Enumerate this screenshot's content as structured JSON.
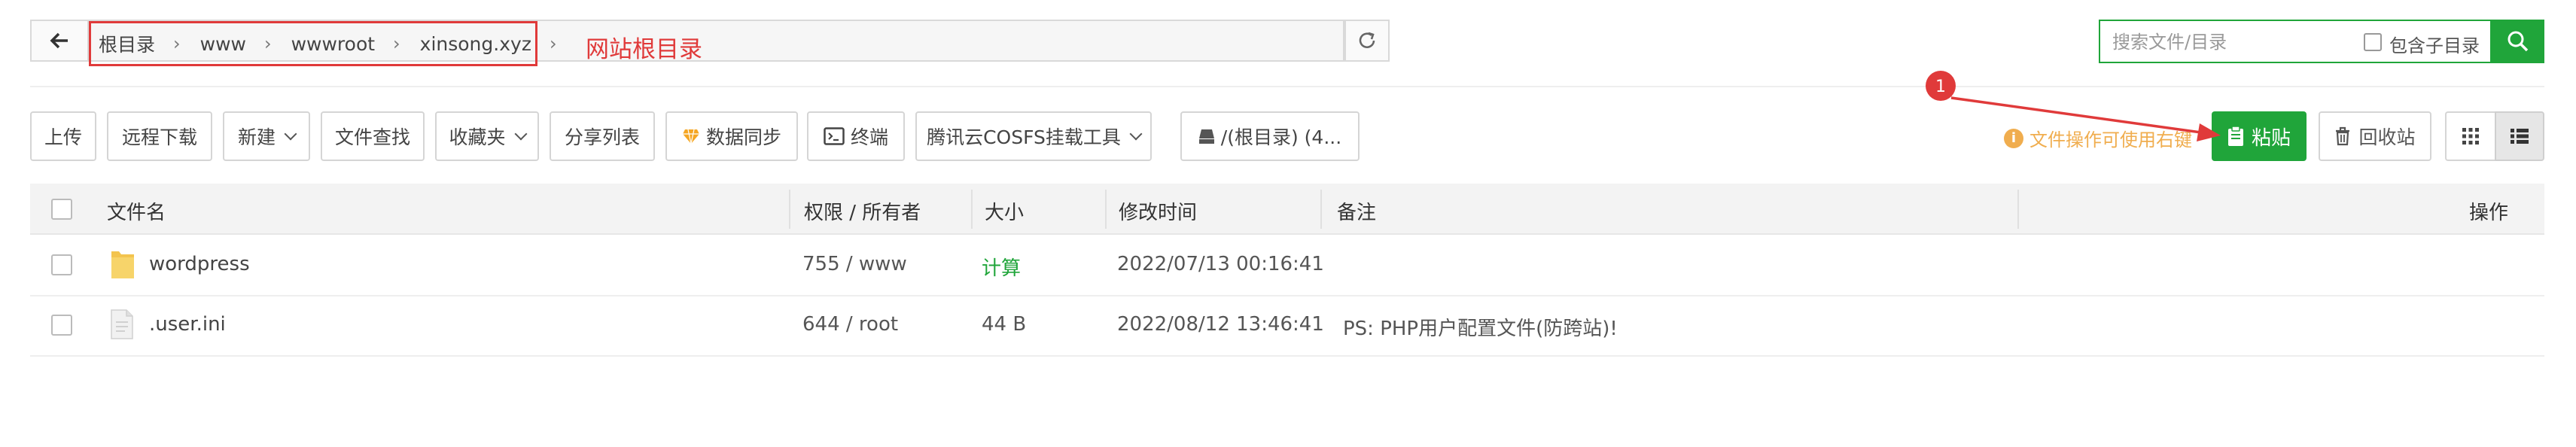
{
  "path_bar": {
    "crumbs": [
      "根目录",
      "www",
      "wwwroot",
      "xinsong.xyz"
    ],
    "annotation": "网站根目录"
  },
  "search": {
    "placeholder": "搜索文件/目录",
    "include_subdir_label": "包含子目录"
  },
  "toolbar": {
    "upload": "上传",
    "remote_download": "远程下载",
    "new": "新建",
    "file_search": "文件查找",
    "favorites": "收藏夹",
    "share_list": "分享列表",
    "data_sync": "数据同步",
    "terminal": "终端",
    "cosfs": "腾讯云COSFS挂载工具",
    "disk": "/(根目录) (4...",
    "tip": "文件操作可使用右键",
    "paste": "粘贴",
    "recycle": "回收站"
  },
  "annotation_marker": "1",
  "table": {
    "headers": {
      "name": "文件名",
      "perm": "权限 / 所有者",
      "size": "大小",
      "mtime": "修改时间",
      "note": "备注",
      "ops": "操作"
    },
    "rows": [
      {
        "name": "wordpress",
        "type": "folder",
        "perm": "755 / www",
        "size": "计算",
        "mtime": "2022/07/13 00:16:41",
        "note": ""
      },
      {
        "name": ".user.ini",
        "type": "file",
        "perm": "644 / root",
        "size": "44 B",
        "mtime": "2022/08/12 13:46:41",
        "note": "PS: PHP用户配置文件(防跨站)!"
      }
    ]
  },
  "colors": {
    "accent": "#20a53a",
    "annotation": "#e03a3a",
    "tip": "#f0ad4e"
  }
}
